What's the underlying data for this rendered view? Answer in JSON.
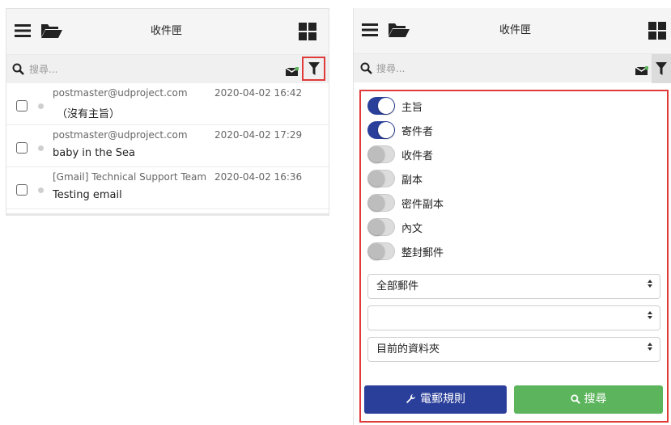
{
  "left": {
    "header": {
      "title": "收件匣"
    },
    "search": {
      "placeholder": "搜尋..."
    },
    "mails": [
      {
        "sender": "postmaster@udproject.com",
        "date": "2020-04-02 16:42",
        "subject": "（沒有主旨）"
      },
      {
        "sender": "postmaster@udproject.com",
        "date": "2020-04-02 17:29",
        "subject": "baby in the Sea"
      },
      {
        "sender": "[Gmail] Technical Support Team",
        "date": "2020-04-02 16:36",
        "subject": "Testing email"
      }
    ]
  },
  "right": {
    "header": {
      "title": "收件匣"
    },
    "search": {
      "placeholder": "搜尋..."
    },
    "filters": [
      {
        "label": "主旨",
        "on": true
      },
      {
        "label": "寄件者",
        "on": true
      },
      {
        "label": "收件者",
        "on": false
      },
      {
        "label": "副本",
        "on": false
      },
      {
        "label": "密件副本",
        "on": false
      },
      {
        "label": "內文",
        "on": false
      },
      {
        "label": "整封郵件",
        "on": false
      }
    ],
    "selects": [
      {
        "value": "全部郵件"
      },
      {
        "value": ""
      },
      {
        "value": "目前的資料夾"
      }
    ],
    "buttons": {
      "mail_rules": "電郵規則",
      "search": "搜尋"
    }
  },
  "colors": {
    "primary": "#2a3f9a",
    "success": "#5cb55c",
    "highlight": "#e03a3a"
  },
  "icons": [
    "menu-icon",
    "folder-open-icon",
    "grid-icon",
    "search-icon",
    "mail-icon",
    "filter-icon",
    "wrench-icon",
    "chevron-updown-icon"
  ]
}
